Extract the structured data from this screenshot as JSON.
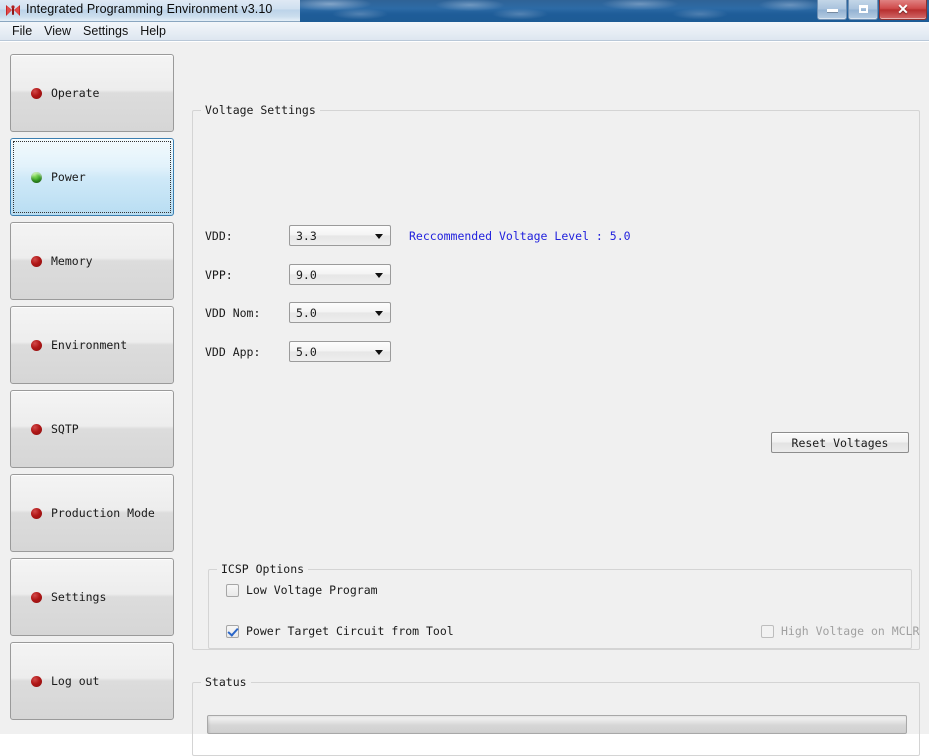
{
  "window": {
    "title": "Integrated Programming Environment v3.10",
    "app_icon": "butterfly-icon",
    "controls": {
      "minimize": "minimize-icon",
      "maximize": "maximize-icon",
      "close": "✕"
    }
  },
  "menubar": {
    "items": [
      {
        "label": "File"
      },
      {
        "label": "View"
      },
      {
        "label": "Settings"
      },
      {
        "label": "Help"
      }
    ]
  },
  "sidebar": {
    "items": [
      {
        "label": "Operate",
        "bullet": "red",
        "selected": false
      },
      {
        "label": "Power",
        "bullet": "green",
        "selected": true
      },
      {
        "label": "Memory",
        "bullet": "red",
        "selected": false
      },
      {
        "label": "Environment",
        "bullet": "red",
        "selected": false
      },
      {
        "label": "SQTP",
        "bullet": "red",
        "selected": false
      },
      {
        "label": "Production Mode",
        "bullet": "red",
        "selected": false
      },
      {
        "label": "Settings",
        "bullet": "red",
        "selected": false
      },
      {
        "label": "Log out",
        "bullet": "red",
        "selected": false
      }
    ]
  },
  "voltage_settings": {
    "title": "Voltage Settings",
    "recommendation": "Reccommended Voltage Level : 5.0",
    "fields": [
      {
        "label": "VDD:",
        "value": "3.3"
      },
      {
        "label": "VPP:",
        "value": "9.0"
      },
      {
        "label": "VDD Nom:",
        "value": "5.0"
      },
      {
        "label": "VDD App:",
        "value": "5.0"
      }
    ],
    "reset_button": "Reset Voltages"
  },
  "icsp_options": {
    "title": "ICSP Options",
    "low_voltage_program": {
      "label": "Low Voltage Program",
      "checked": false,
      "disabled": false
    },
    "power_target_circuit": {
      "label": "Power Target Circuit from Tool",
      "checked": true,
      "disabled": false
    },
    "high_voltage_mclr": {
      "label": "High Voltage on MCLR",
      "checked": false,
      "disabled": true
    }
  },
  "status": {
    "title": "Status",
    "progress_text": "",
    "progress_percent": 0
  },
  "colors": {
    "accent_blue": "#2222dd",
    "selected_border": "#3c7fb1",
    "bullet_red": "#b01717",
    "bullet_green": "#3faa2a",
    "titlebar_blue": "#2d6ba6",
    "close_red": "#cf4a4a"
  }
}
